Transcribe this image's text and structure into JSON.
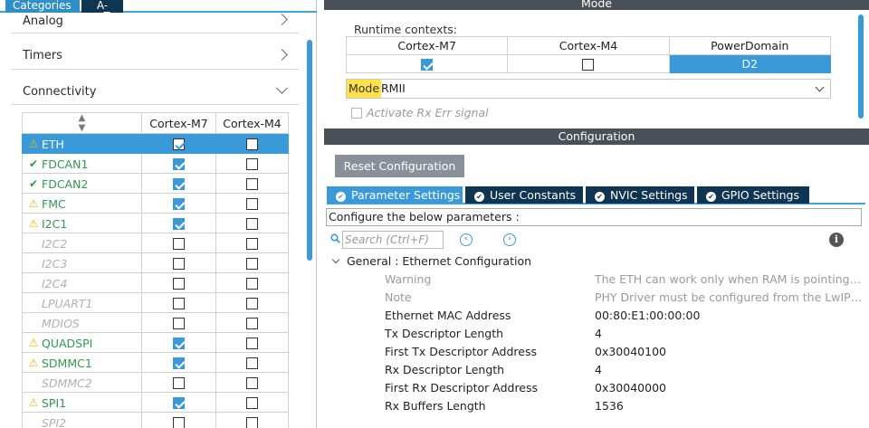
{
  "left_tabs": {
    "categories": "Categories",
    "az": "A->Z"
  },
  "categories": [
    {
      "label": "Analog"
    },
    {
      "label": "Timers"
    },
    {
      "label": "Connectivity"
    }
  ],
  "periph_table": {
    "headers": [
      "",
      "Cortex-M7",
      "Cortex-M4"
    ],
    "rows": [
      {
        "name": "ETH",
        "status": "warn",
        "m7": true,
        "m4": false,
        "selected": true
      },
      {
        "name": "FDCAN1",
        "status": "ok",
        "m7": true,
        "m4": false
      },
      {
        "name": "FDCAN2",
        "status": "ok",
        "m7": true,
        "m4": false
      },
      {
        "name": "FMC",
        "status": "warn",
        "m7": true,
        "m4": false
      },
      {
        "name": "I2C1",
        "status": "warn",
        "m7": true,
        "m4": false
      },
      {
        "name": "I2C2",
        "status": "off",
        "m7": false,
        "m4": false
      },
      {
        "name": "I2C3",
        "status": "off",
        "m7": false,
        "m4": false
      },
      {
        "name": "I2C4",
        "status": "off",
        "m7": false,
        "m4": false
      },
      {
        "name": "LPUART1",
        "status": "off",
        "m7": false,
        "m4": false
      },
      {
        "name": "MDIOS",
        "status": "off",
        "m7": false,
        "m4": false
      },
      {
        "name": "QUADSPI",
        "status": "warn",
        "m7": true,
        "m4": false
      },
      {
        "name": "SDMMC1",
        "status": "warn",
        "m7": true,
        "m4": false
      },
      {
        "name": "SDMMC2",
        "status": "off",
        "m7": false,
        "m4": false
      },
      {
        "name": "SPI1",
        "status": "warn",
        "m7": true,
        "m4": false
      },
      {
        "name": "SPI2",
        "status": "off",
        "m7": false,
        "m4": false
      }
    ]
  },
  "mode": {
    "header": "Mode",
    "runtime_label": "Runtime contexts:",
    "runtime_headers": [
      "Cortex-M7",
      "Cortex-M4",
      "PowerDomain"
    ],
    "runtime_m7": true,
    "runtime_m4": false,
    "power_domain": "D2",
    "mode_label": "Mode",
    "mode_value": "RMII",
    "rx_err_label": "Activate Rx Err signal"
  },
  "configuration": {
    "header": "Configuration",
    "reset_button": "Reset Configuration",
    "tabs": [
      "Parameter Settings",
      "User Constants",
      "NVIC Settings",
      "GPIO Settings"
    ],
    "caption": "Configure the below parameters :",
    "search_placeholder": "Search (Ctrl+F)",
    "group_label": "General : Ethernet Configuration",
    "params": [
      {
        "label": "Warning",
        "value": "The ETH can work only when RAM is pointing a...",
        "dim": true
      },
      {
        "label": "Note",
        "value": "PHY Driver must be configured from the LwIP 'Pl...",
        "dim": true
      },
      {
        "label": "Ethernet MAC Address",
        "value": "00:80:E1:00:00:00"
      },
      {
        "label": "Tx Descriptor Length",
        "value": "4"
      },
      {
        "label": "First Tx Descriptor Address",
        "value": "0x30040100"
      },
      {
        "label": "Rx Descriptor Length",
        "value": "4"
      },
      {
        "label": "First Rx Descriptor Address",
        "value": "0x30040000"
      },
      {
        "label": "Rx Buffers Length",
        "value": "1536"
      }
    ]
  },
  "colors": {
    "accent": "#3a9ad9",
    "dark_tab": "#0f3553",
    "section_header": "#495057",
    "warning": "#e6b800",
    "ok": "#2f9a4c"
  },
  "icons": {
    "warn": "warning-triangle-icon",
    "ok": "check-icon",
    "info": "info-icon",
    "search": "search-icon"
  }
}
